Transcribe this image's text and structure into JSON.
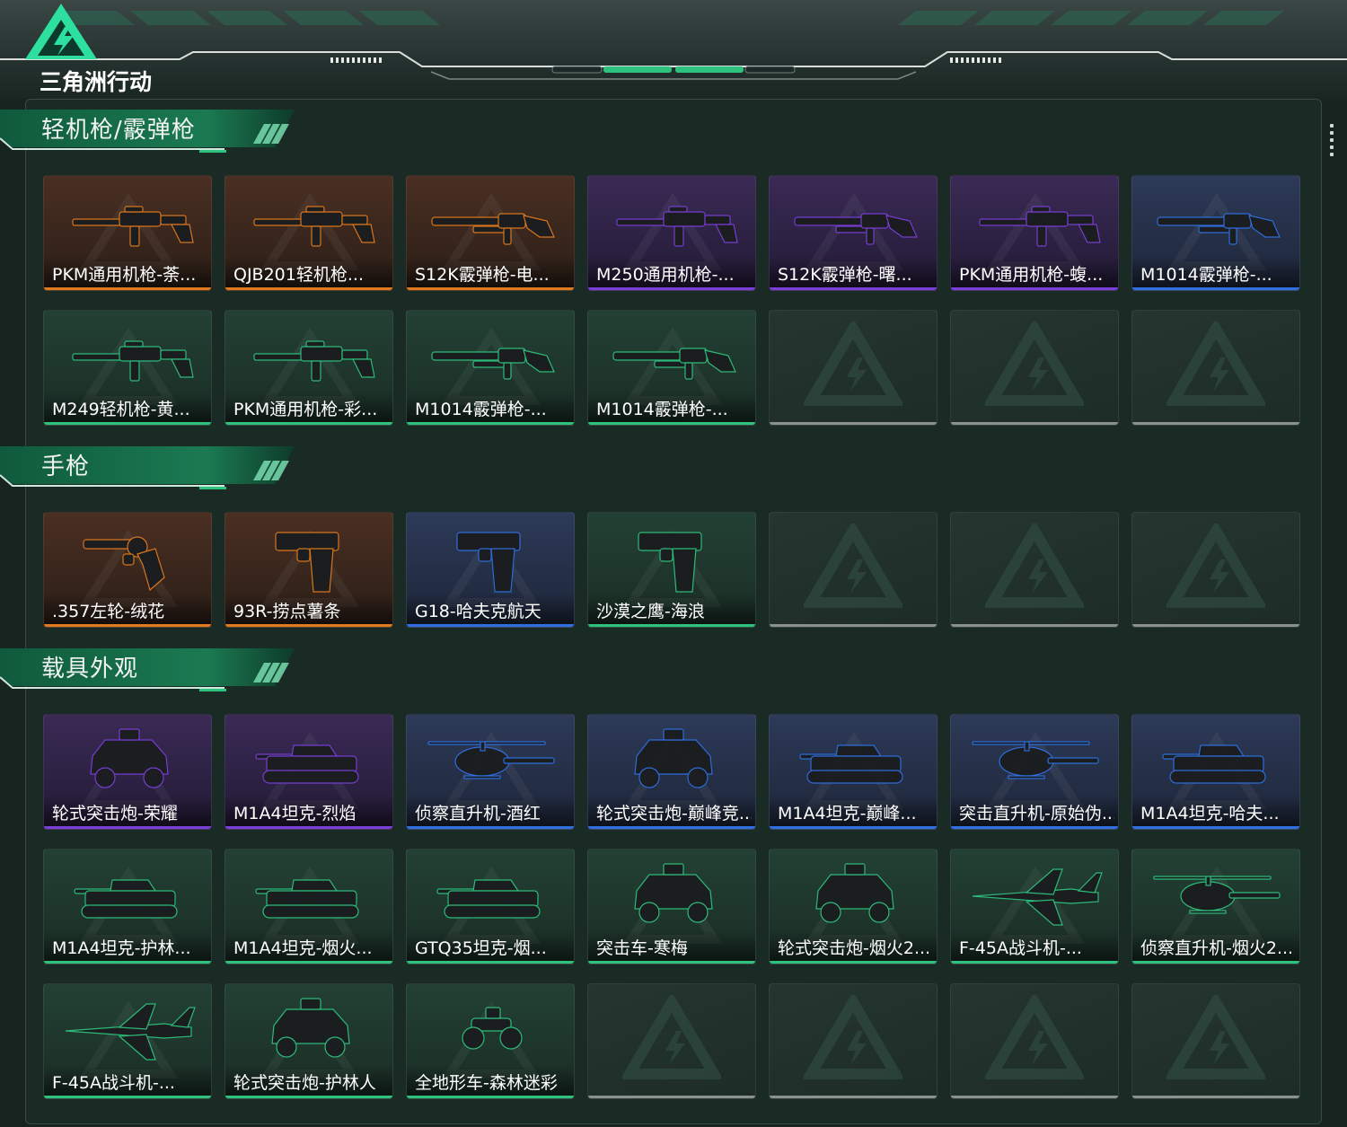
{
  "app": {
    "logo_text": "三角洲行动"
  },
  "colors": {
    "gold": {
      "bg_top": "#4a2f22",
      "bg_bottom": "#2a1e17",
      "bar": "#e07a1f"
    },
    "purple": {
      "bg_top": "#3a2a55",
      "bg_bottom": "#221a35",
      "bar": "#7a3fd8"
    },
    "blue": {
      "bg_top": "#2d3a58",
      "bg_bottom": "#1d2638",
      "bar": "#2f6fe0"
    },
    "green": {
      "bg_top": "#234034",
      "bg_bottom": "#1a2d25",
      "bar": "#2ec27e"
    },
    "empty_bar": "#8a918e"
  },
  "sections": [
    {
      "title": "轻机枪/霰弹枪",
      "items": [
        {
          "name": "PKM通用机枪-荼...",
          "rarity": "gold",
          "icon": "machine-gun-icon"
        },
        {
          "name": "QJB201轻机枪...",
          "rarity": "gold",
          "icon": "machine-gun-icon"
        },
        {
          "name": "S12K霰弹枪-电...",
          "rarity": "gold",
          "icon": "shotgun-icon"
        },
        {
          "name": "M250通用机枪-...",
          "rarity": "purple",
          "icon": "machine-gun-icon"
        },
        {
          "name": "S12K霰弹枪-曙...",
          "rarity": "purple",
          "icon": "shotgun-icon"
        },
        {
          "name": "PKM通用机枪-蝮...",
          "rarity": "purple",
          "icon": "machine-gun-icon"
        },
        {
          "name": "M1014霰弹枪-...",
          "rarity": "blue",
          "icon": "shotgun-icon"
        },
        {
          "name": "M249轻机枪-黄...",
          "rarity": "green",
          "icon": "machine-gun-icon"
        },
        {
          "name": "PKM通用机枪-彩...",
          "rarity": "green",
          "icon": "machine-gun-icon"
        },
        {
          "name": "M1014霰弹枪-...",
          "rarity": "green",
          "icon": "shotgun-icon"
        },
        {
          "name": "M1014霰弹枪-...",
          "rarity": "green",
          "icon": "shotgun-icon"
        },
        null,
        null,
        null
      ]
    },
    {
      "title": "手枪",
      "items": [
        {
          "name": ".357左轮-绒花",
          "rarity": "gold",
          "icon": "revolver-icon"
        },
        {
          "name": "93R-捞点薯条",
          "rarity": "gold",
          "icon": "pistol-icon"
        },
        {
          "name": "G18-哈夫克航天",
          "rarity": "blue",
          "icon": "pistol-icon"
        },
        {
          "name": "沙漠之鹰-海浪",
          "rarity": "green",
          "icon": "pistol-icon"
        },
        null,
        null,
        null
      ]
    },
    {
      "title": "载具外观",
      "items": [
        {
          "name": "轮式突击炮-荣耀",
          "rarity": "purple",
          "icon": "armored-car-icon"
        },
        {
          "name": "M1A4坦克-烈焰",
          "rarity": "purple",
          "icon": "tank-icon"
        },
        {
          "name": "侦察直升机-酒红",
          "rarity": "blue",
          "icon": "helicopter-icon"
        },
        {
          "name": "轮式突击炮-巅峰竞...",
          "rarity": "blue",
          "icon": "armored-car-icon"
        },
        {
          "name": "M1A4坦克-巅峰...",
          "rarity": "blue",
          "icon": "tank-icon"
        },
        {
          "name": "突击直升机-原始伪...",
          "rarity": "blue",
          "icon": "helicopter-icon"
        },
        {
          "name": "M1A4坦克-哈夫...",
          "rarity": "blue",
          "icon": "tank-icon"
        },
        {
          "name": "M1A4坦克-护林...",
          "rarity": "green",
          "icon": "tank-icon"
        },
        {
          "name": "M1A4坦克-烟火...",
          "rarity": "green",
          "icon": "tank-icon"
        },
        {
          "name": "GTQ35坦克-烟...",
          "rarity": "green",
          "icon": "tank-icon"
        },
        {
          "name": "突击车-寒梅",
          "rarity": "green",
          "icon": "armored-car-icon"
        },
        {
          "name": "轮式突击炮-烟火2...",
          "rarity": "green",
          "icon": "armored-car-icon"
        },
        {
          "name": "F-45A战斗机-...",
          "rarity": "green",
          "icon": "fighter-jet-icon"
        },
        {
          "name": "侦察直升机-烟火2...",
          "rarity": "green",
          "icon": "helicopter-icon"
        },
        {
          "name": "F-45A战斗机-...",
          "rarity": "green",
          "icon": "fighter-jet-icon"
        },
        {
          "name": "轮式突击炮-护林人",
          "rarity": "green",
          "icon": "armored-car-icon"
        },
        {
          "name": "全地形车-森林迷彩",
          "rarity": "green",
          "icon": "atv-icon"
        },
        null,
        null,
        null,
        null
      ]
    }
  ]
}
